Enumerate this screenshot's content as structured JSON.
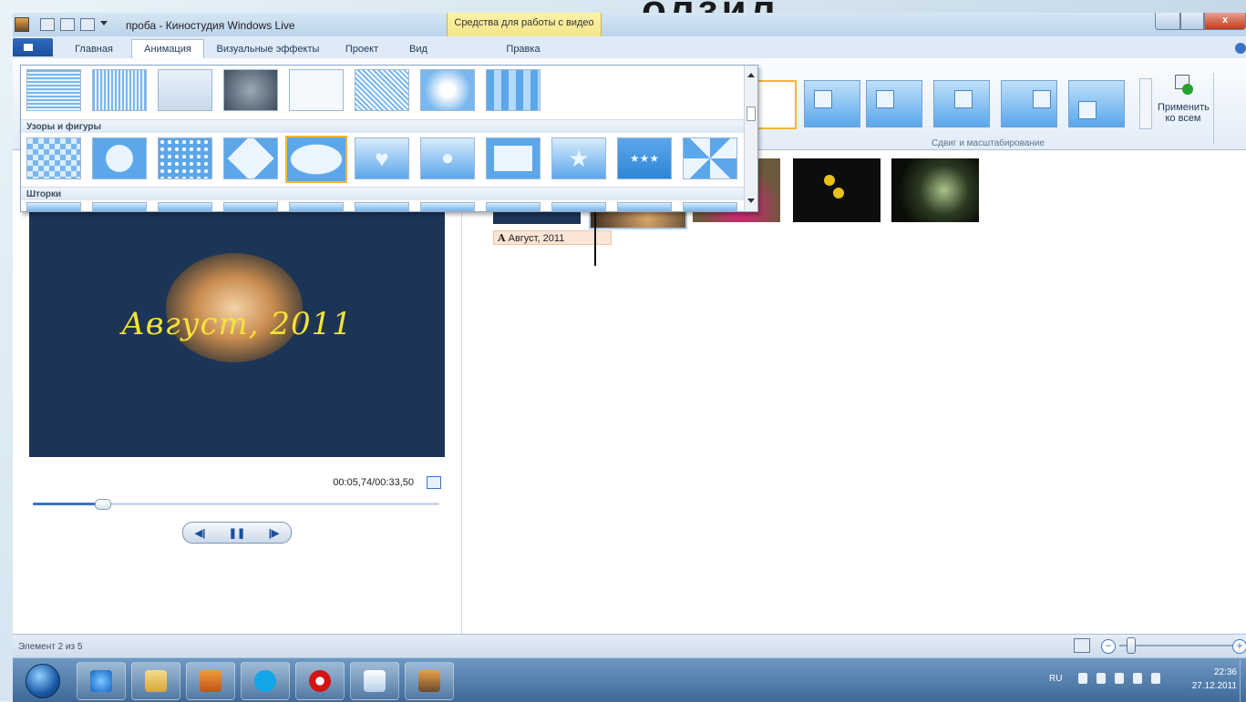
{
  "background_title": "олзил",
  "window": {
    "title": "проба - Киностудия Windows Live",
    "context_tab": "Средства для работы с видео",
    "close_glyph": "x"
  },
  "tabs": [
    {
      "label": "Главная",
      "active": false
    },
    {
      "label": "Анимация",
      "active": true
    },
    {
      "label": "Визуальные эффекты",
      "active": false
    },
    {
      "label": "Проект",
      "active": false
    },
    {
      "label": "Вид",
      "active": false
    },
    {
      "label": "Правка",
      "active": false
    }
  ],
  "ribbon": {
    "group_label": "Сдвиг и масштабирование",
    "apply_all_label": "Применить ко всем"
  },
  "gallery": {
    "sections": [
      {
        "label": "Узоры и фигуры"
      },
      {
        "label": "Шторки"
      }
    ],
    "shape_symbols": {
      "heart": "♥",
      "star": "★",
      "stars": "★★★"
    },
    "grip": "....",
    "selected_item": "oval"
  },
  "preview": {
    "caption": "Август, 2011",
    "timecode": "00:05,74/00:33,50",
    "progress": 0.17,
    "transport": {
      "prev": "◀|",
      "pause": "❚❚",
      "next": "|▶"
    }
  },
  "storyboard": {
    "caption_text": "Август, 2011",
    "caption_prefix": "A"
  },
  "statusbar": {
    "element_status": "Элемент 2 из 5",
    "zoom_out": "−",
    "zoom_in": "+",
    "zoom_level": 0.1
  },
  "taskbar": {
    "apps": [
      "ie-icon",
      "explorer-icon",
      "media-player-icon",
      "skype-icon",
      "opera-icon",
      "presentation-icon",
      "movie-maker-icon"
    ],
    "language": "RU",
    "time": "22:36",
    "date": "27.12.2011"
  }
}
